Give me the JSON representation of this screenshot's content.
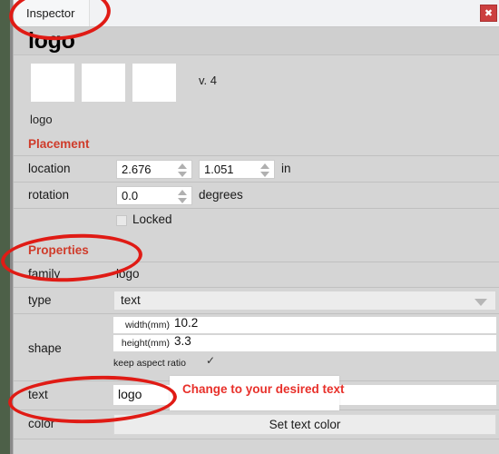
{
  "window": {
    "tab_label": "Inspector",
    "close_label": "✖",
    "title": "logo",
    "version": "v. 4",
    "sub_label": "logo"
  },
  "sections": {
    "placement": {
      "heading": "Placement",
      "location": {
        "label": "location",
        "x_value": "2.676",
        "y_value": "1.051",
        "unit": "in"
      },
      "rotation": {
        "label": "rotation",
        "value": "0.0",
        "unit": "degrees"
      },
      "locked": {
        "label": "Locked",
        "checked": false
      }
    },
    "properties": {
      "heading": "Properties",
      "family": {
        "label": "family",
        "value": "logo"
      },
      "type": {
        "label": "type",
        "value": "text"
      },
      "shape": {
        "label": "shape",
        "width_label": "width(mm)",
        "width_value": "10.2",
        "height_label": "height(mm)",
        "height_value": "3.3",
        "aspect_label": "keep aspect ratio",
        "aspect_check": "✓"
      },
      "text": {
        "label": "text",
        "value": "logo"
      },
      "color": {
        "label": "color",
        "button_label": "Set text color"
      }
    }
  },
  "annotation": {
    "tooltip_text": "Change to your desired text"
  },
  "colors": {
    "annotation_red": "#e01b15",
    "section_heading_red": "#cf3b2a",
    "close_button_red": "#cc3f3f",
    "desktop_green": "#4d6048",
    "panel_gray": "#d5d5d5"
  },
  "icons": {
    "spinner_up": "triangle-up-icon",
    "spinner_down": "triangle-down-icon",
    "dropdown_caret": "chevron-down-icon",
    "close": "close-icon",
    "checkmark": "check-icon"
  }
}
